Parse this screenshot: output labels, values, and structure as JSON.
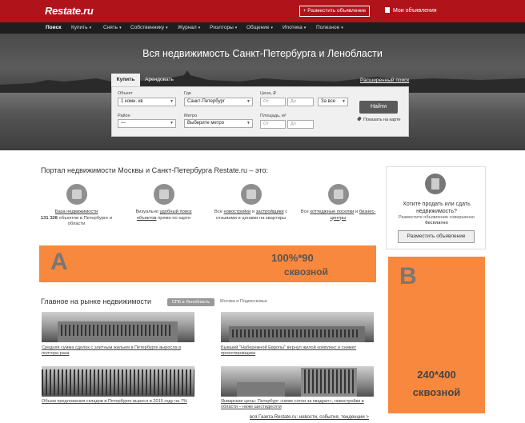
{
  "header": {
    "logo": "Restate.ru",
    "post_button": "+ Разместить объявление",
    "my_ads": "Мои объявления"
  },
  "nav": {
    "items": [
      {
        "label": "Поиск",
        "active": true
      },
      {
        "label": "Купить"
      },
      {
        "label": "Снять"
      },
      {
        "label": "Собственнику"
      },
      {
        "label": "Журнал"
      },
      {
        "label": "Риэлторы"
      },
      {
        "label": "Общение"
      },
      {
        "label": "Ипотека"
      },
      {
        "label": "Полезное"
      }
    ],
    "caret": "▾"
  },
  "hero": {
    "title": "Вся недвижимость Санкт-Петербурга и Ленобласти",
    "tabs": {
      "buy": "Купить",
      "rent": "Арендовать"
    },
    "advanced_search": "Расширенный поиск",
    "fields": {
      "object_label": "Объект",
      "object_value": "1 комн. кв",
      "where_label": "Где",
      "where_value": "Санкт-Петербург",
      "price_label": "Цена, ₽",
      "price_from": "От",
      "price_to": "До",
      "price_period": "За все",
      "district_label": "Район",
      "district_value": "—",
      "metro_label": "Метро",
      "metro_value": "Выберите метро",
      "area_label": "Площадь, м²",
      "area_from": "От",
      "area_to": "До"
    },
    "find_button": "Найти",
    "map_link": "Показать на карте"
  },
  "portal": {
    "title": "Портал недвижимости Москвы и Санкт-Петербурга Restate.ru – это:",
    "features": [
      {
        "icon": "house-icon",
        "link": "База недвижимости",
        "bold": "131 328",
        "text": "объектов в Петербурге и области"
      },
      {
        "icon": "map-pin-icon",
        "pre": "Визуально",
        "link": "удобный поиск объектов",
        "text": "прямо по карте"
      },
      {
        "icon": "crane-icon",
        "pre": "Все",
        "link": "новостройки",
        "mid": "и",
        "link2": "застройщики",
        "text": "с отзывами и ценами на квартиры"
      },
      {
        "icon": "cottage-icon",
        "pre": "Все",
        "link": "коттеджные поселки",
        "mid": "и",
        "link2": "бизнес-центры",
        "text": ""
      }
    ]
  },
  "sell_card": {
    "title": "Хотите продать или сдать недвижимость?",
    "subtitle": "Разместите объявление совершенно",
    "subtitle_bold": "бесплатно",
    "button": "Разместить объявление"
  },
  "ads": {
    "a": {
      "letter": "A",
      "line1": "100%*90",
      "line2": "сквозной"
    },
    "b": {
      "letter": "B",
      "line1": "240*400",
      "line2": "сквозной"
    }
  },
  "news": {
    "title": "Главное на рынке недвижимости",
    "filter_active": "СПб и Ленобласть",
    "filter_other": "Москва и Подмосковье",
    "items": [
      {
        "caption": "Средняя сумма сделок с элитным жильем в Петербурге выросла в полтора раза"
      },
      {
        "caption": "Бывший \"Набережной Европы\" вернул жилой комплекс и снимет проектировщика"
      },
      {
        "caption": "Объем предложения складов в Петербурге выросл в 2015 году на 7%"
      },
      {
        "caption": "Январские цены: Петербург «ниже сотни за квадрат», новостройки в области – ниже шестидесяти"
      }
    ],
    "all_link": "вся Газета Restate.ru: новости, события, тенденции >"
  }
}
